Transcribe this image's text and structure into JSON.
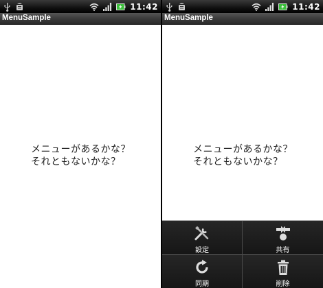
{
  "status_bar": {
    "time": "11:42"
  },
  "app": {
    "title": "MenuSample"
  },
  "content": {
    "line1": "メニューがあるかな？",
    "line2": "それともないかな？"
  },
  "options_menu": {
    "items": [
      {
        "label": "設定",
        "icon": "tools-icon"
      },
      {
        "label": "共有",
        "icon": "share-icon"
      },
      {
        "label": "同期",
        "icon": "sync-icon"
      },
      {
        "label": "削除",
        "icon": "trash-icon"
      }
    ]
  },
  "colors": {
    "menu_background": "#1c1c1c",
    "title_bar": "#3b3b3b",
    "status_bar": "#111111",
    "battery_green": "#3cbf3c"
  }
}
